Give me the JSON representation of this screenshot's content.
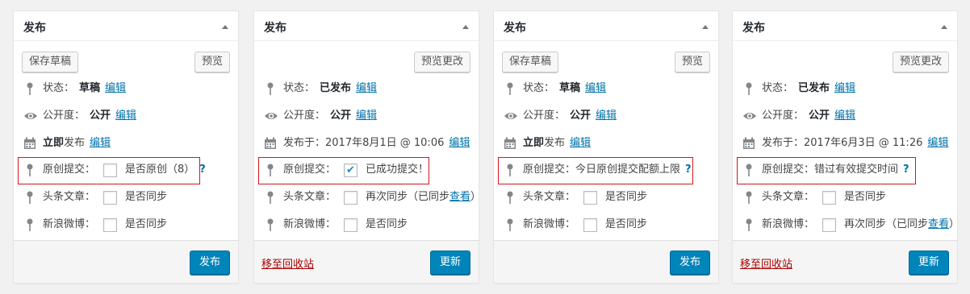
{
  "panels": [
    {
      "title": "发布",
      "save_draft": "保存草稿",
      "preview": "预览",
      "status_label": "状态：",
      "status_value": "草稿",
      "edit": "编辑",
      "visibility_label": "公开度：",
      "visibility_value": "公开",
      "schedule_bold": "立即",
      "schedule_text": "发布",
      "original_label": "原创提交：",
      "original_text": "是否原创（8）",
      "help": "?",
      "toutiao_label": "头条文章：",
      "toutiao_text": "是否同步",
      "weibo_label": "新浪微博：",
      "weibo_text": "是否同步",
      "action": "发布"
    },
    {
      "title": "发布",
      "preview": "预览更改",
      "status_label": "状态：",
      "status_value": "已发布",
      "edit": "编辑",
      "visibility_label": "公开度：",
      "visibility_value": "公开",
      "schedule_text": "发布于：2017年8月1日 @ 10:06",
      "original_label": "原创提交：",
      "original_text": "已成功提交！",
      "toutiao_label": "头条文章：",
      "toutiao_text": "再次同步（已同步",
      "toutiao_link": "查看",
      "toutiao_close": "）",
      "weibo_label": "新浪微博：",
      "weibo_text": "是否同步",
      "trash": "移至回收站",
      "action": "更新"
    },
    {
      "title": "发布",
      "save_draft": "保存草稿",
      "preview": "预览",
      "status_label": "状态：",
      "status_value": "草稿",
      "edit": "编辑",
      "visibility_label": "公开度：",
      "visibility_value": "公开",
      "schedule_bold": "立即",
      "schedule_text": "发布",
      "original_label": "原创提交：",
      "original_text": "今日原创提交配额上限",
      "help": "?",
      "toutiao_label": "头条文章：",
      "toutiao_text": "是否同步",
      "weibo_label": "新浪微博：",
      "weibo_text": "是否同步",
      "action": "发布"
    },
    {
      "title": "发布",
      "preview": "预览更改",
      "status_label": "状态：",
      "status_value": "已发布",
      "edit": "编辑",
      "visibility_label": "公开度：",
      "visibility_value": "公开",
      "schedule_text": "发布于：2017年6月3日 @ 11:26",
      "original_label": "原创提交：",
      "original_text": "错过有效提交时间",
      "help": "?",
      "toutiao_label": "头条文章：",
      "toutiao_text": "是否同步",
      "weibo_label": "新浪微博：",
      "weibo_text": "再次同步（已同步",
      "weibo_link": "查看",
      "weibo_close": "）",
      "trash": "移至回收站",
      "action": "更新"
    }
  ],
  "colors": {
    "accent": "#0085ba",
    "link": "#0073aa",
    "danger": "#a00",
    "highlight": "#d6151b"
  },
  "icons": [
    "pin-icon",
    "eye-icon",
    "calendar-icon",
    "checkmark-icon",
    "collapse-arrow-icon"
  ]
}
